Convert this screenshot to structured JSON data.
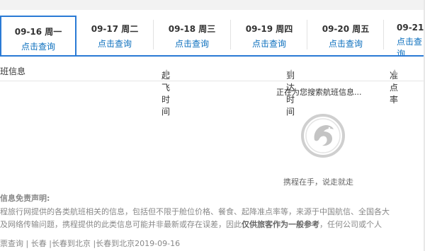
{
  "date_tabs": [
    {
      "date": "09-16 周一",
      "action": "点击查询",
      "active": true
    },
    {
      "date": "09-17 周二",
      "action": "点击查询",
      "active": false
    },
    {
      "date": "09-18 周三",
      "action": "点击查询",
      "active": false
    },
    {
      "date": "09-19 周四",
      "action": "点击查询",
      "active": false
    },
    {
      "date": "09-20 周五",
      "action": "点击查询",
      "active": false
    },
    {
      "date": "09-21",
      "action": "点击查询",
      "active": false
    }
  ],
  "table_header": {
    "flight_info": "班信息",
    "depart_time": "起飞时间",
    "arrive_time": "到达时间",
    "on_time_rate": "准点率"
  },
  "status": {
    "searching_text": "正在为您搜索航班信息...",
    "slogan": "携程在手，说走就走"
  },
  "disclaimer": {
    "title": "信息免责声明:",
    "line1": "程旅行网提供的各类航班相关的信息，包括但不限于舱位价格、餐食、起降准点率等，来源于中国航信、全国各大",
    "line2_prefix": "及网络传输问题，携程提供的此类信息可能并非最新或存在误差，因此",
    "line2_bold": "仅供旅客作为一般参考",
    "line2_suffix": "，任何公司或个人"
  },
  "breadcrumb": {
    "item1": "票查询",
    "item2": "长春",
    "item3": "长春到北京",
    "item4": "长春到北京2019-09-16"
  },
  "colors": {
    "accent": "#2a7ad5",
    "link": "#0a6ebd"
  }
}
